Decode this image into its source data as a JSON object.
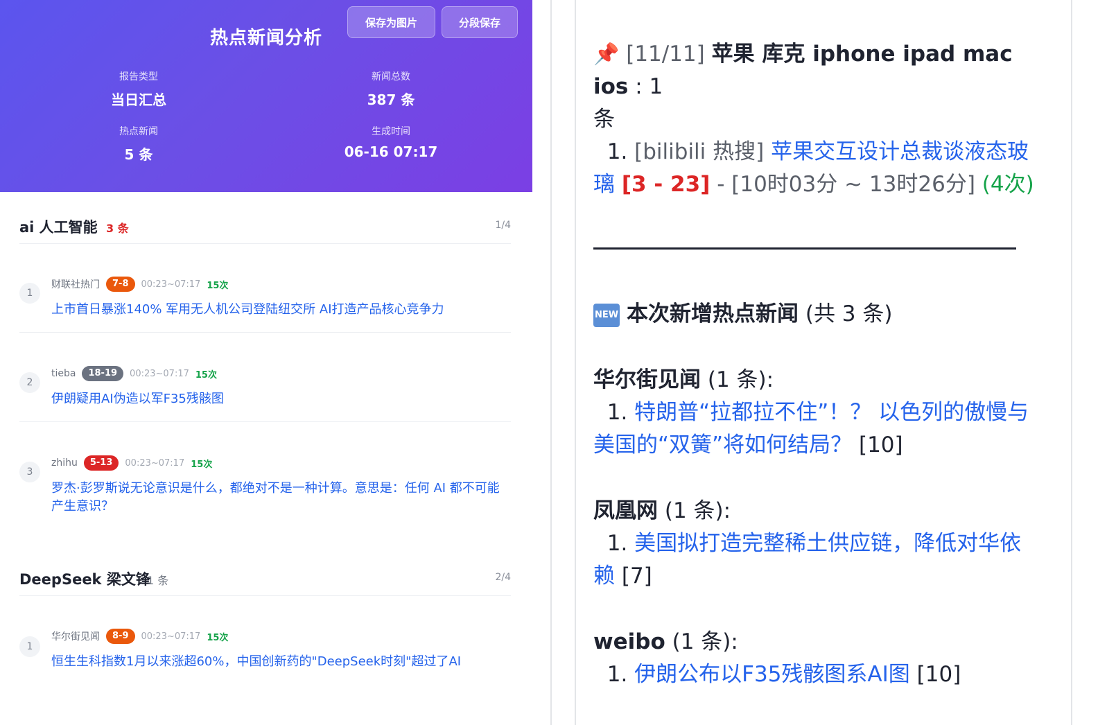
{
  "header": {
    "title": "热点新闻分析",
    "save_image_label": "保存为图片",
    "save_segment_label": "分段保存",
    "stats": [
      {
        "label": "报告类型",
        "value": "当日汇总"
      },
      {
        "label": "新闻总数",
        "value": "387 条"
      },
      {
        "label": "热点新闻",
        "value": "5 条"
      },
      {
        "label": "生成时间",
        "value": "06-16 07:17"
      }
    ]
  },
  "groups": [
    {
      "name": "ai 人工智能",
      "count": "3 条",
      "page": "1/4",
      "items": [
        {
          "rank": "1",
          "source": "财联社热门",
          "badge": "7-8",
          "time": "00:23~07:17",
          "count": "15次",
          "title": "上市首日暴涨140% 军用无人机公司登陆纽交所 AI打造产品核心竞争力"
        },
        {
          "rank": "2",
          "source": "tieba",
          "badge": "18-19",
          "time": "00:23~07:17",
          "count": "15次",
          "title": "伊朗疑用AI伪造以军F35残骸图"
        },
        {
          "rank": "3",
          "source": "zhihu",
          "badge": "5-13",
          "time": "00:23~07:17",
          "count": "15次",
          "title": "罗杰·彭罗斯说无论意识是什么，都绝对不是一种计算。意思是：任何 AI 都不可能产生意识？"
        }
      ]
    },
    {
      "name": "DeepSeek 梁文锋",
      "count": "1 条",
      "page": "2/4",
      "items": [
        {
          "rank": "1",
          "source": "华尔街见闻",
          "badge": "8-9",
          "time": "00:23~07:17",
          "count": "15次",
          "title": "恒生生科指数1月以来涨超60%，中国创新药的\"DeepSeek时刻\"超过了AI"
        }
      ]
    }
  ],
  "right": {
    "pin_icon": "pushpin-icon",
    "keyword_prefix": "[11/11]",
    "keyword_text": "苹果 库克 iphone ipad mac ios",
    "keyword_suffix": " : 1",
    "keyword_unit": "条",
    "entry_num": "1.",
    "entry_source": "[bilibili 热搜]",
    "entry_title_a": "苹果交互设计总裁谈液态玻",
    "entry_title_b": "璃",
    "entry_rank": "[3 - 23]",
    "entry_dash": "-",
    "entry_time": "[10时03分 ~ 13时26分]",
    "entry_count": "(4次)",
    "new_icon_text": "NEW",
    "new_title": "本次新增热点新闻",
    "new_total": "(共 3 条)",
    "sources": [
      {
        "name": "华尔街见闻",
        "count": "(1 条):",
        "num": "1.",
        "title_a": "特朗普“拉都拉不住”！？ 以色列的傲慢与",
        "title_b": "美国的“双簧”将如何结局？",
        "rank": "[10]"
      },
      {
        "name": "凤凰网",
        "count": "(1 条):",
        "num": "1.",
        "title_a": "美国拟打造完整稀土供应链，降低对华依",
        "title_b": "赖",
        "rank": "[7]"
      },
      {
        "name": "weibo",
        "count": "(1 条):",
        "num": "1.",
        "title_a": "伊朗公布以F35残骸图系AI图",
        "title_b": "",
        "rank": "[10]"
      }
    ]
  }
}
